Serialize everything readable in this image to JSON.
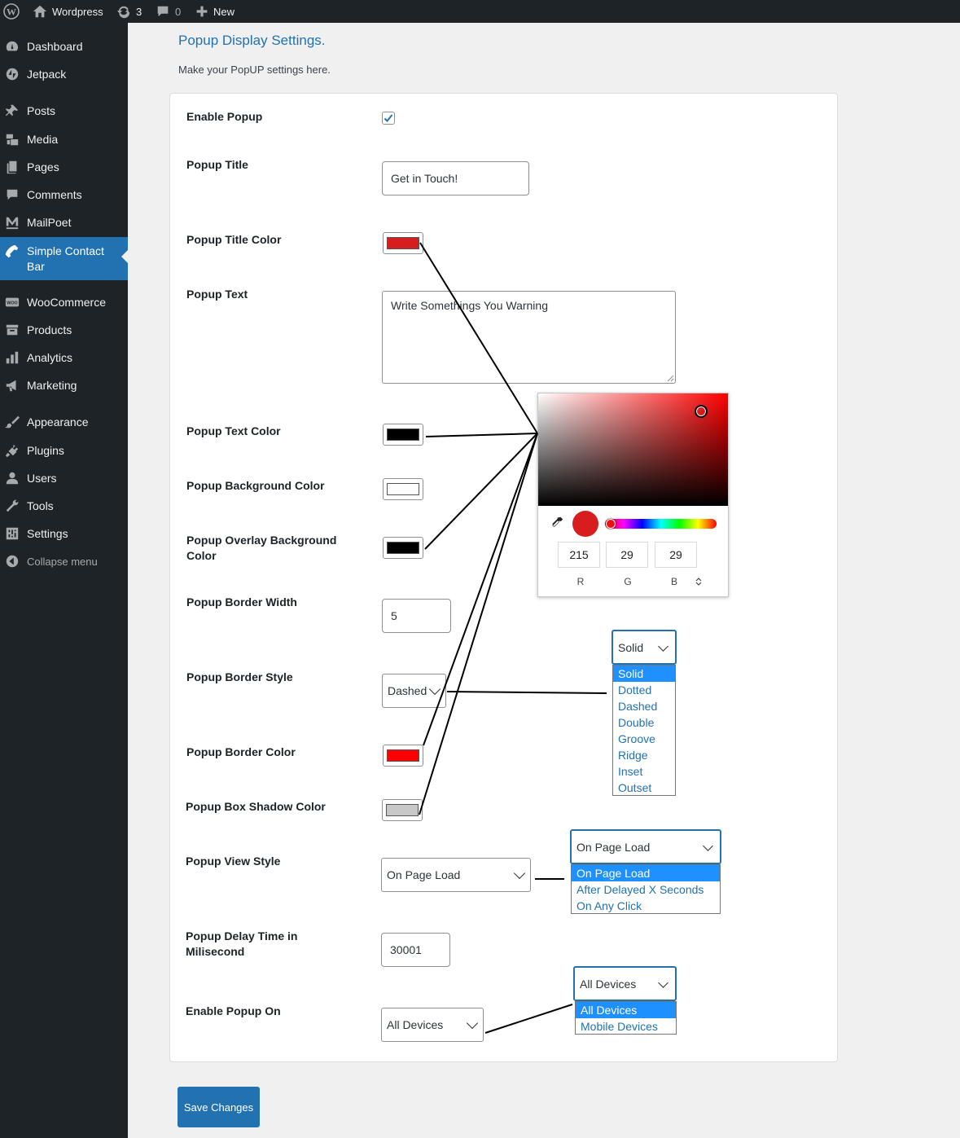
{
  "admin_bar": {
    "site_name": "Wordpress",
    "updates_count": "3",
    "comments_count": "0",
    "new_label": "New"
  },
  "sidebar": {
    "items": [
      {
        "label": "Dashboard",
        "icon": "dashboard-icon"
      },
      {
        "label": "Jetpack",
        "icon": "jetpack-icon"
      },
      {
        "label": "Posts",
        "icon": "pin-icon"
      },
      {
        "label": "Media",
        "icon": "media-icon"
      },
      {
        "label": "Pages",
        "icon": "pages-icon"
      },
      {
        "label": "Comments",
        "icon": "comment-icon"
      },
      {
        "label": "MailPoet",
        "icon": "mailpoet-icon"
      },
      {
        "label": "Simple Contact Bar",
        "icon": "phone-icon",
        "active": true
      },
      {
        "label": "WooCommerce",
        "icon": "woo-icon"
      },
      {
        "label": "Products",
        "icon": "archive-icon"
      },
      {
        "label": "Analytics",
        "icon": "bar-chart-icon"
      },
      {
        "label": "Marketing",
        "icon": "megaphone-icon"
      },
      {
        "label": "Appearance",
        "icon": "brush-icon"
      },
      {
        "label": "Plugins",
        "icon": "plug-icon"
      },
      {
        "label": "Users",
        "icon": "user-icon"
      },
      {
        "label": "Tools",
        "icon": "wrench-icon"
      },
      {
        "label": "Settings",
        "icon": "settings-icon"
      },
      {
        "label": "Collapse menu",
        "icon": "collapse-icon"
      }
    ]
  },
  "page": {
    "title": "Popup Display Settings.",
    "subtitle": "Make your PopUP settings here."
  },
  "form": {
    "enable_popup": {
      "label": "Enable Popup",
      "checked": true
    },
    "popup_title": {
      "label": "Popup Title",
      "value": "Get in Touch!"
    },
    "popup_title_color": {
      "label": "Popup Title Color",
      "color": "#d71d1d"
    },
    "popup_text": {
      "label": "Popup Text",
      "value": "Write Somethings You Warning"
    },
    "popup_text_color": {
      "label": "Popup Text Color",
      "color": "#000000"
    },
    "popup_bg_color": {
      "label": "Popup Background Color",
      "color": "#ffffff"
    },
    "popup_overlay_color": {
      "label": "Popup Overlay Background Color",
      "color": "#000000"
    },
    "popup_border_width": {
      "label": "Popup Border Width",
      "value": "5"
    },
    "popup_border_style": {
      "label": "Popup Border Style",
      "value": "Dashed"
    },
    "popup_border_color": {
      "label": "Popup Border Color",
      "color": "#ff0000"
    },
    "popup_shadow_color": {
      "label": "Popup Box Shadow Color",
      "color": "#c8c8c8"
    },
    "popup_view_style": {
      "label": "Popup View Style",
      "value": "On Page Load"
    },
    "popup_delay": {
      "label": "Popup Delay Time in Milisecond",
      "value": "30001"
    },
    "enable_popup_on": {
      "label": "Enable Popup On",
      "value": "All Devices"
    }
  },
  "color_picker": {
    "r": "215",
    "g": "29",
    "b": "29",
    "r_label": "R",
    "g_label": "G",
    "b_label": "B",
    "hue_color": "#ff0000"
  },
  "border_style_dropdown": {
    "selected": "Solid",
    "options": [
      "Solid",
      "Dotted",
      "Dashed",
      "Double",
      "Groove",
      "Ridge",
      "Inset",
      "Outset"
    ],
    "highlighted": "Solid"
  },
  "view_style_dropdown": {
    "selected": "On Page Load",
    "options": [
      "On Page Load",
      "After Delayed X Seconds",
      "On Any Click"
    ],
    "highlighted": "On Page Load"
  },
  "devices_dropdown": {
    "selected": "All Devices",
    "options": [
      "All Devices",
      "Mobile Devices"
    ],
    "highlighted": "All Devices"
  },
  "save_label": "Save Changes",
  "colors": {
    "accent": "#2271b1",
    "admin_dark": "#1d2327"
  }
}
